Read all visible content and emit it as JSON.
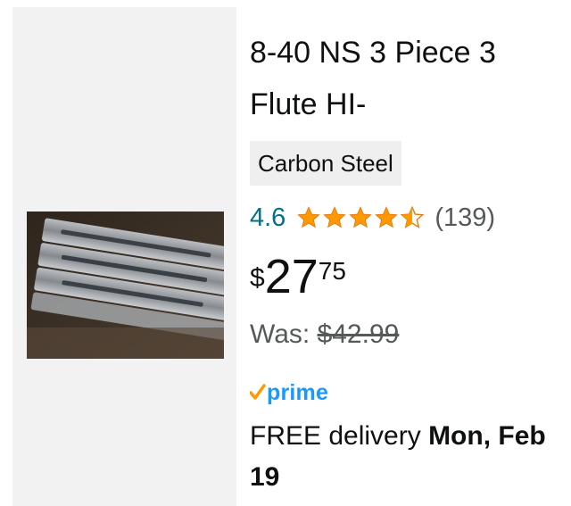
{
  "product": {
    "title": "8-40 NS 3 Piece 3 Flute HI-",
    "badge": "Carbon Steel",
    "rating": {
      "value": "4.6",
      "stars": 4.5,
      "count": "(139)",
      "star_color": "#ff9900"
    },
    "price": {
      "symbol": "$",
      "whole": "27",
      "fraction": "75"
    },
    "was": {
      "label": "Was: ",
      "price": "$42.99"
    },
    "prime": {
      "label": "prime",
      "color": "#1a98ff",
      "check_color": "#ff9900"
    },
    "delivery": {
      "prefix": "FREE delivery ",
      "date": "Mon, Feb 19"
    },
    "image_icon": "tap-set-in-plastic-cases"
  }
}
